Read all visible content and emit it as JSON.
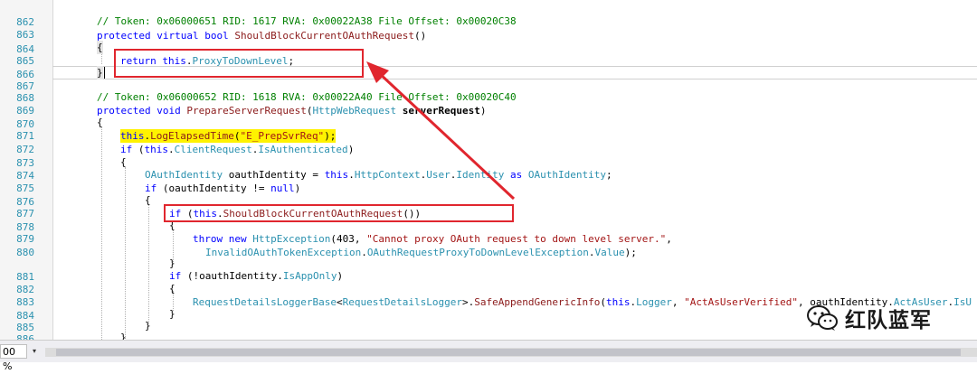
{
  "editor": {
    "lines": [
      {
        "num": "862"
      },
      {
        "num": "863",
        "comment": "// Token: 0x06000651 RID: 1617 RVA: 0x00022A38 File Offset: 0x00020C38"
      },
      {
        "num": "864",
        "kw1": "protected",
        "kw2": "virtual",
        "kw3": "bool",
        "method": "ShouldBlockCurrentOAuthRequest",
        "tail": "()"
      },
      {
        "num": "865",
        "text": "{"
      },
      {
        "num": "866",
        "kw1": "return",
        "kw2": "this",
        "dot": ".",
        "prop": "ProxyToDownLevel",
        "tail": ";"
      },
      {
        "num": "867",
        "text": "}"
      },
      {
        "num": "868"
      },
      {
        "num": "869",
        "comment": "// Token: 0x06000652 RID: 1618 RVA: 0x00022A40 File Offset: 0x00020C40"
      },
      {
        "num": "870",
        "kw1": "protected",
        "kw2": "void",
        "method": "PrepareServerRequest",
        "open": "(",
        "type": "HttpWebRequest",
        "param": "serverRequest",
        "close": ")"
      },
      {
        "num": "871",
        "text": "{"
      },
      {
        "num": "872",
        "kw": "this",
        "dot": ".",
        "method": "LogElapsedTime",
        "open": "(",
        "str": "\"E_PrepSvrReq\"",
        "close": ");"
      },
      {
        "num": "873",
        "kw1": "if",
        "mid1": " (",
        "kw2": "this",
        "dot1": ".",
        "prop1": "ClientRequest",
        "dot2": ".",
        "prop2": "IsAuthenticated",
        "close": ")"
      },
      {
        "num": "874",
        "text": "{"
      },
      {
        "num": "875",
        "type": "OAuthIdentity",
        "var": " oauthIdentity = ",
        "kw": "this",
        "dot1": ".",
        "prop1": "HttpContext",
        "dot2": ".",
        "prop2": "User",
        "dot3": ".",
        "prop3": "Identity",
        "kw2": " as ",
        "type2": "OAuthIdentity",
        "tail": ";"
      },
      {
        "num": "876",
        "kw1": "if",
        "mid": " (oauthIdentity != ",
        "kw2": "null",
        "close": ")"
      },
      {
        "num": "877",
        "text": "{"
      },
      {
        "num": "878",
        "kw1": "if",
        "mid": " (",
        "kw2": "this",
        "dot": ".",
        "method": "ShouldBlockCurrentOAuthRequest",
        "close": "())"
      },
      {
        "num": "879",
        "text": "{"
      },
      {
        "num": "880",
        "kw1": "throw",
        "kw2": "new",
        "type": "HttpException",
        "mid": "(403, ",
        "str": "\"Cannot proxy OAuth request to down level server.\"",
        "tail": ","
      },
      {
        "num": "",
        "type1": "InvalidOAuthTokenException",
        "dot1": ".",
        "prop1": "OAuthRequestProxyToDownLevelException",
        "dot2": ".",
        "prop2": "Value",
        "tail": ");"
      },
      {
        "num": "881",
        "text": "}"
      },
      {
        "num": "882",
        "kw1": "if",
        "mid": " (!oauthIdentity.",
        "prop": "IsAppOnly",
        "close": ")"
      },
      {
        "num": "883",
        "text": "{"
      },
      {
        "num": "884",
        "type1": "RequestDetailsLoggerBase",
        "lt": "<",
        "type2": "RequestDetailsLogger",
        "gt": ">.",
        "method": "SafeAppendGenericInfo",
        "open": "(",
        "kw": "this",
        "dot": ".",
        "prop": "Logger",
        "mid": ", ",
        "str": "\"ActAsUserVerified\"",
        "tail": ", oauthIdentity.",
        "prop2": "ActAsUser",
        "dot2": ".",
        "prop3": "IsU"
      },
      {
        "num": "885",
        "text": "}"
      },
      {
        "num": "886",
        "text": "}"
      },
      {
        "num": "887",
        "text": "}"
      }
    ]
  },
  "status": {
    "zoom": "00 %",
    "zoom_arrow": "▾"
  },
  "watermark": {
    "text": "红队蓝军",
    "icon": "wechat-icon"
  },
  "colors": {
    "annotation": "#e0262e",
    "highlight": "#fff200",
    "keyword": "#0000ff",
    "type": "#2b91af",
    "method": "#8b1a1a",
    "comment": "#008000",
    "string": "#a31515"
  }
}
